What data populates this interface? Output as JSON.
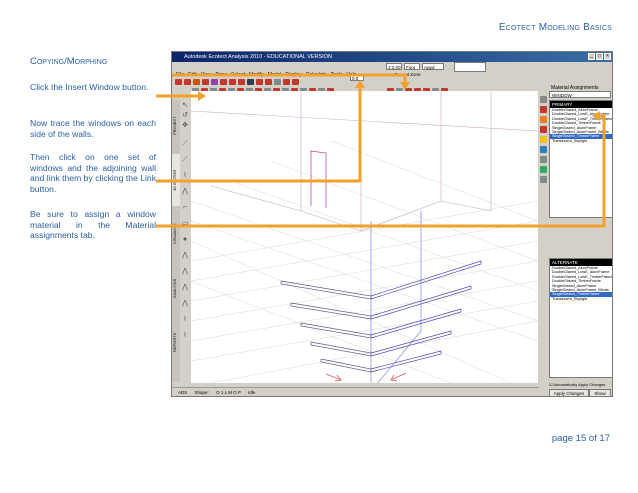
{
  "header": {
    "title": "Ecotect Modeling Basics"
  },
  "section": {
    "title": "Copying/Morphing"
  },
  "paragraphs": [
    "Click the Insert Window button.",
    "Now trace the windows on each side of the walls.",
    "Then click on one set of windows and the adjoining wall and link them by clicking the Link button.",
    "Be sure to assign a window material in the Material assignments tab."
  ],
  "footer": {
    "page_label": "page 15 of 17"
  },
  "colors": {
    "accent_text": "#2a5fa8",
    "arrow": "#f2a12d",
    "titlebar": "#0a246a"
  },
  "app": {
    "window_title": "Autodesk Ecotect Analysis 2010 - EDUCATIONAL VERSION",
    "menu": [
      "File",
      "Edit",
      "View",
      "Draw",
      "Select",
      "Modify",
      "Model",
      "Display",
      "Calculate",
      "Tools",
      "Help"
    ],
    "toolbar_fields": {
      "zone_size": "3 2.00",
      "zone_unit": "Foot",
      "view_mode": "Appd",
      "zoom": "0.0"
    },
    "current_zone_label": "Current Zone",
    "vertical_tabs": [
      "PROJECT",
      "3D EDITOR",
      "VISUALISE",
      "ANALYSIS",
      "REPORTS"
    ],
    "left_tool_icons": [
      "cursor-icon",
      "wall-icon",
      "line-icon",
      "curve-icon",
      "zigzag-icon",
      "stair-icon",
      "dot-icon"
    ],
    "status": {
      "left": "ADS",
      "shape": "Shape:",
      "snap": "O 1 L M O P",
      "idle": "Idle"
    },
    "material_panel": {
      "title": "Material Assignments",
      "dropdown": "WINDOW",
      "primary_header": "PRIMARY",
      "primary_items": [
        "DoubleGlazed_AlumFrame",
        "DoubleGlazed_LowE_AlumFrame",
        "DoubleGlazed_LowE_TimberFrame",
        "DoubleGlazed_TimberFrame",
        "SingleGlazed_AlumFrame",
        "SingleGlazed_AlumFrame_Blinds",
        "SingleGlazed_TimberFrame",
        "Translucent_Skylight"
      ],
      "primary_selected_index": 6,
      "alternate_header": "ALTERNATE",
      "alternate_items": [
        "DoubleGlazed_AlumFrame",
        "DoubleGlazed_LowE_AlumFrame",
        "DoubleGlazed_LowE_TimberFrame",
        "DoubleGlazed_TimberFrame",
        "SingleGlazed_AlumFrame",
        "SingleGlazed_AlumFrame_Blinds",
        "SingleGlazed_TimberFrame",
        "Translucent_Skylight"
      ],
      "alternate_selected_index": 6,
      "auto_apply_label": "Automatically Apply Changes",
      "apply_button": "Apply Changes",
      "show_button": "Show"
    }
  }
}
